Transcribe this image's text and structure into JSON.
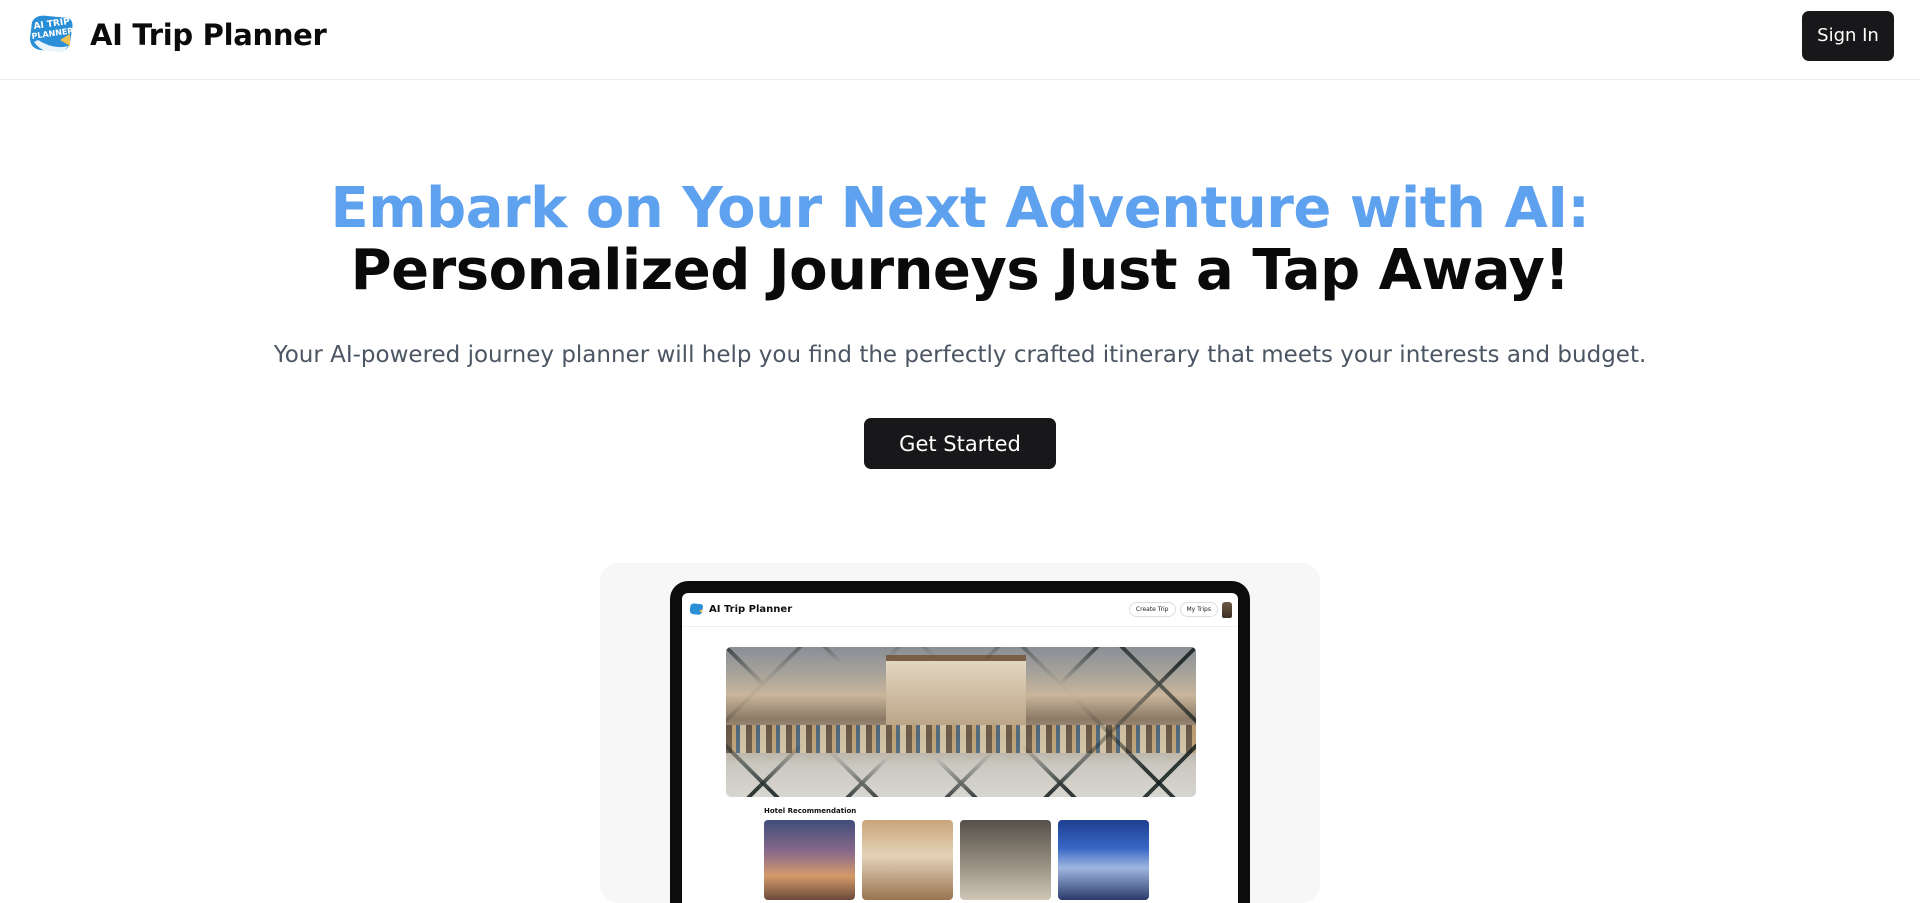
{
  "header": {
    "brand_name": "AI Trip Planner",
    "logo_icon": "ai-trip-planner-logo",
    "signin_label": "Sign In"
  },
  "hero": {
    "title_line1": "Embark on Your Next Adventure with AI:",
    "title_line2": "Personalized Journeys Just a Tap Away!",
    "subtitle": "Your AI-powered journey planner will help you find the perfectly crafted itinerary that meets your interests and budget.",
    "cta_label": "Get Started"
  },
  "preview": {
    "brand_name": "AI Trip Planner",
    "nav": {
      "create_trip": "Create Trip",
      "my_trips": "My Trips"
    },
    "section_title": "Hotel Recommendation",
    "hotel_count": 4
  },
  "colors": {
    "accent": "#5ea1ef",
    "button_bg": "#18181b",
    "subtitle": "#4b5563"
  }
}
